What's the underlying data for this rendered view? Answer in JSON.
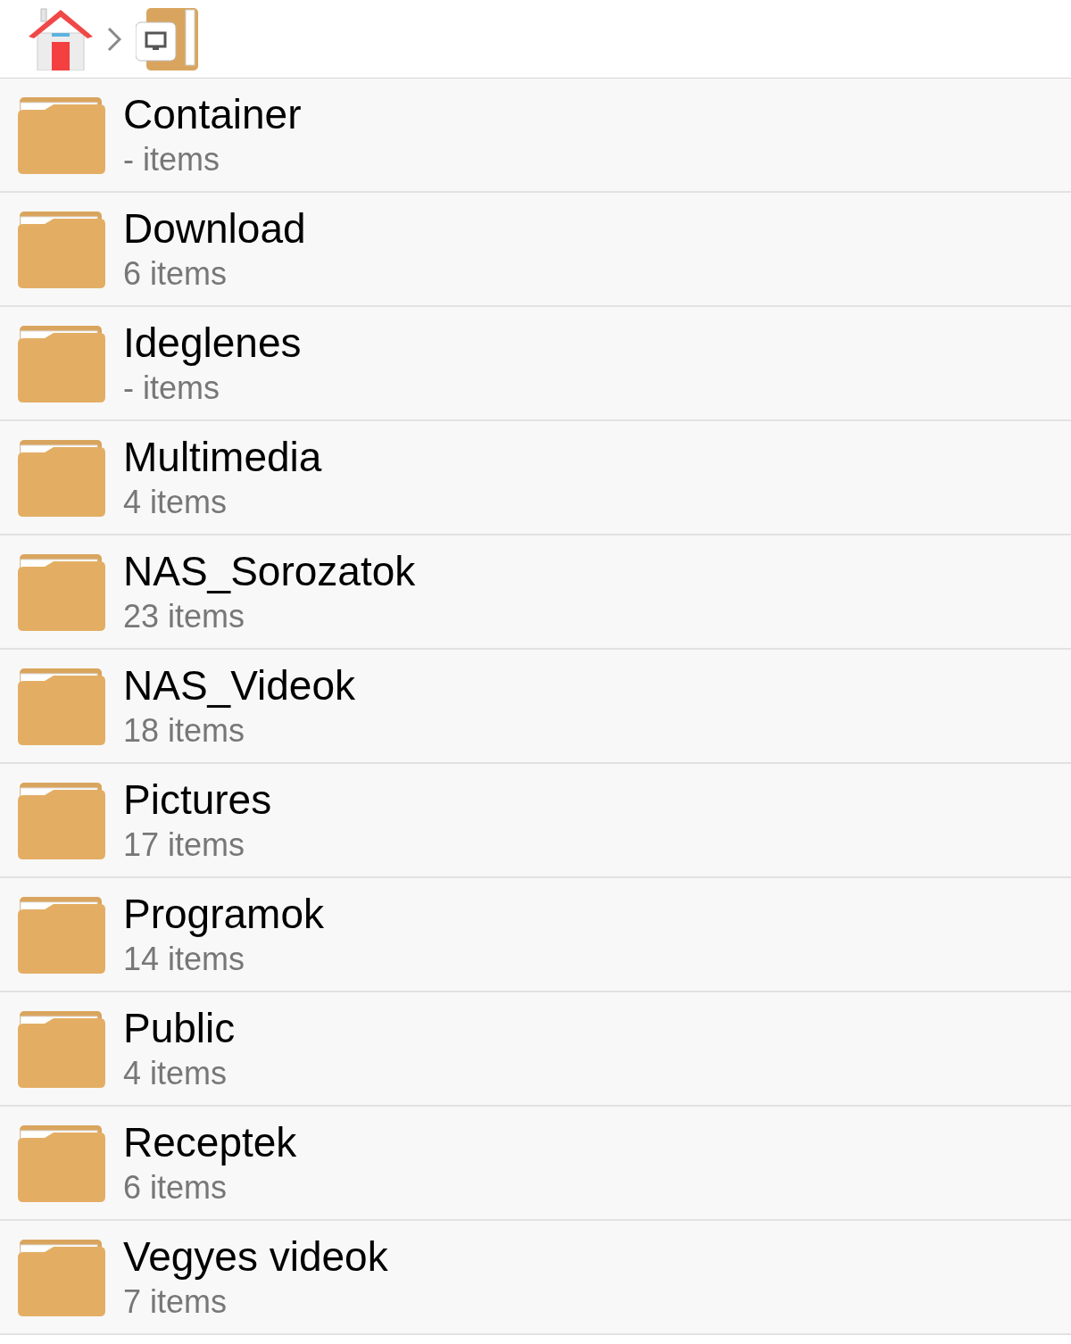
{
  "folders": [
    {
      "name": "Container",
      "count": "- items"
    },
    {
      "name": "Download",
      "count": "6 items"
    },
    {
      "name": "Ideglenes",
      "count": "- items"
    },
    {
      "name": "Multimedia",
      "count": "4 items"
    },
    {
      "name": "NAS_Sorozatok",
      "count": "23 items"
    },
    {
      "name": "NAS_Videok",
      "count": "18 items"
    },
    {
      "name": "Pictures",
      "count": "17 items"
    },
    {
      "name": "Programok",
      "count": "14 items"
    },
    {
      "name": "Public",
      "count": "4 items"
    },
    {
      "name": "Receptek",
      "count": "6 items"
    },
    {
      "name": "Vegyes videok",
      "count": "7 items"
    }
  ]
}
